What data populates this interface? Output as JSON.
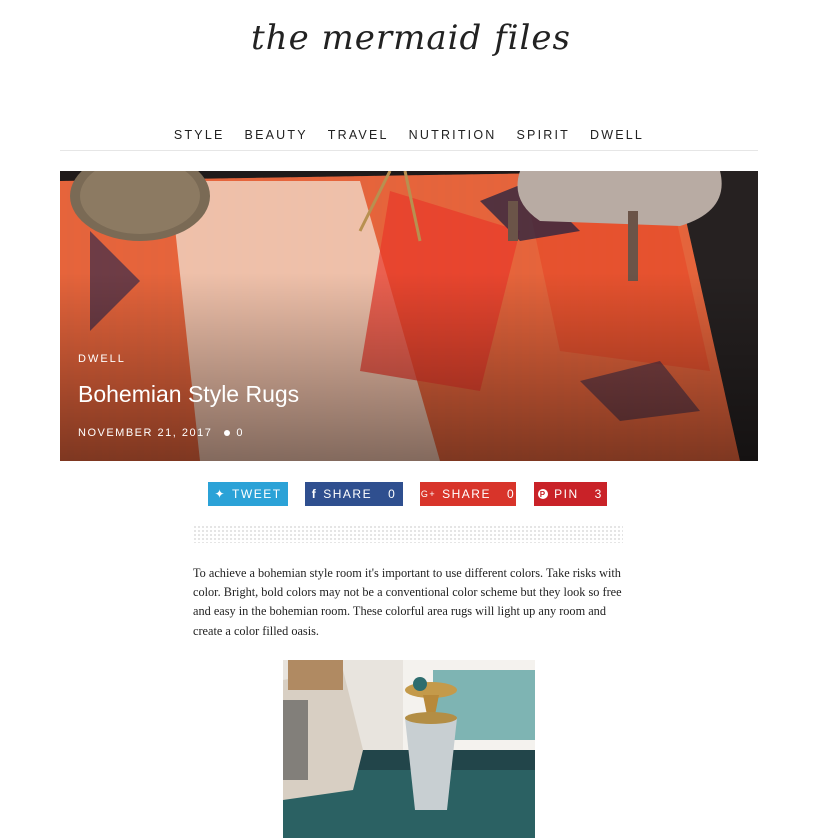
{
  "site": {
    "logo_text": "the mermaid files"
  },
  "nav": {
    "items": [
      "STYLE",
      "BEAUTY",
      "TRAVEL",
      "NUTRITION",
      "SPIRIT",
      "DWELL"
    ]
  },
  "hero": {
    "category": "DWELL",
    "title": "Bohemian Style Rugs",
    "date": "NOVEMBER 21, 2017",
    "comments": "0",
    "icon": "comment-icon"
  },
  "share": {
    "tweet": {
      "icon": "twitter-icon",
      "glyph": "✦",
      "label": "TWEET",
      "color": "#2ba2d7"
    },
    "facebook": {
      "icon": "facebook-icon",
      "glyph": "f",
      "label": "SHARE",
      "count": "0",
      "color": "#2f4f8f"
    },
    "google": {
      "icon": "google-plus-icon",
      "glyph": "G+",
      "label": "SHARE",
      "count": "0",
      "color": "#d8342a"
    },
    "pinterest": {
      "icon": "pinterest-icon",
      "glyph": "P",
      "label": "PIN",
      "count": "3",
      "color": "#c92228"
    }
  },
  "article": {
    "paragraph": "To achieve a bohemian style room it's important to use different colors. Take risks with color. Bright, bold colors may not be a conventional color scheme but they look so free and easy in the bohemian room. These colorful area rugs will light up any room and create a color filled oasis."
  }
}
